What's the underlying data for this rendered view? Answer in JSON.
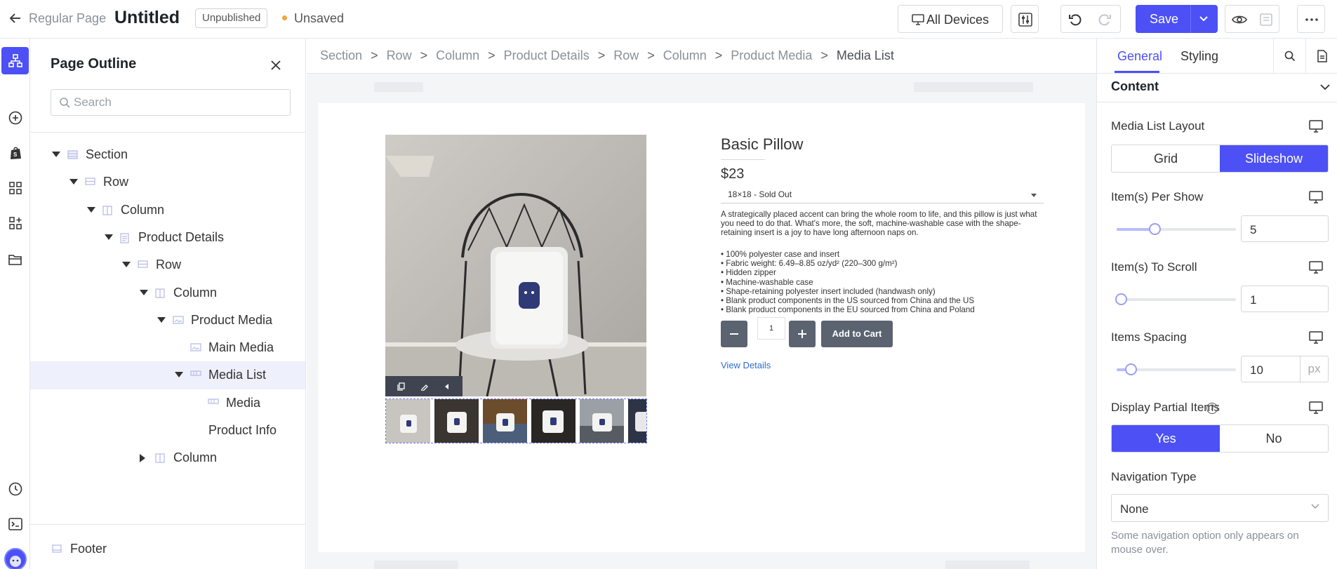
{
  "topbar": {
    "back_label": "Regular Page",
    "title": "Untitled",
    "status_badge": "Unpublished",
    "save_state": "Unsaved",
    "devices_label": "All Devices",
    "save_label": "Save"
  },
  "rail": {
    "icons": [
      "page-outline-icon",
      "add-element-icon",
      "shopify-icon",
      "apps-grid-icon",
      "widgets-icon",
      "folder-icon",
      "history-icon",
      "code-icon",
      "avatar"
    ]
  },
  "outline": {
    "title": "Page Outline",
    "search_placeholder": "Search",
    "items": [
      {
        "label": "Section",
        "depth": 0,
        "caret": "down",
        "icon": "section"
      },
      {
        "label": "Row",
        "depth": 1,
        "caret": "down",
        "icon": "row"
      },
      {
        "label": "Column",
        "depth": 2,
        "caret": "down",
        "icon": "column"
      },
      {
        "label": "Product Details",
        "depth": 3,
        "caret": "down",
        "icon": "product"
      },
      {
        "label": "Row",
        "depth": 4,
        "caret": "down",
        "icon": "row"
      },
      {
        "label": "Column",
        "depth": 5,
        "caret": "down",
        "icon": "column"
      },
      {
        "label": "Product Media",
        "depth": 6,
        "caret": "down",
        "icon": "media"
      },
      {
        "label": "Main Media",
        "depth": 7,
        "caret": "none",
        "icon": "media"
      },
      {
        "label": "Media List",
        "depth": 7,
        "caret": "down",
        "icon": "list",
        "selected": true
      },
      {
        "label": "Media",
        "depth": 8,
        "caret": "none",
        "icon": "list"
      },
      {
        "label": "Product Info",
        "depth": 7,
        "caret": "none",
        "icon": "none"
      },
      {
        "label": "Column",
        "depth": 5,
        "caret": "right",
        "icon": "column"
      }
    ],
    "footer_label": "Footer"
  },
  "breadcrumb": [
    "Section",
    "Row",
    "Column",
    "Product Details",
    "Row",
    "Column",
    "Product Media",
    "Media List"
  ],
  "product": {
    "title": "Basic Pillow",
    "price": "$23",
    "variant": "18×18 - Sold Out",
    "description": "A strategically placed accent can bring the whole room to life, and this pillow is just what you need to do that. What's more, the soft, machine-washable case with the shape-retaining insert is a joy to have long afternoon naps on.",
    "bullets": [
      "• 100% polyester case and insert",
      "• Fabric weight: 6.49–8.85 oz/yd² (220–300 g/m²)",
      "• Hidden zipper",
      "• Machine-washable case",
      "• Shape-retaining polyester insert included (handwash only)",
      "• Blank product components in the US sourced from China and the US",
      "• Blank product components in the EU sourced from China and Poland"
    ],
    "quantity": "1",
    "add_to_cart": "Add to Cart",
    "view_details": "View Details"
  },
  "panel": {
    "tabs": [
      "General",
      "Styling"
    ],
    "active_tab": "General",
    "section_title": "Content",
    "media_list_layout": {
      "label": "Media List Layout",
      "options": [
        "Grid",
        "Slideshow"
      ],
      "selected": "Slideshow"
    },
    "items_per_show": {
      "label": "Item(s) Per Show",
      "value": "5",
      "fraction": 0.28
    },
    "items_to_scroll": {
      "label": "Item(s) To Scroll",
      "value": "1",
      "fraction": 0.0
    },
    "items_spacing": {
      "label": "Items Spacing",
      "value": "10",
      "unit": "px",
      "fraction": 0.08
    },
    "display_partial": {
      "label": "Display Partial Items",
      "options": [
        "Yes",
        "No"
      ],
      "selected": "Yes"
    },
    "navigation_type": {
      "label": "Navigation Type",
      "value": "None"
    },
    "note": "Some navigation option only appears on mouse over."
  },
  "colors": {
    "accent": "#4c50f5",
    "unsaved_dot": "#f0a43a",
    "button_dark": "#5b6270"
  }
}
